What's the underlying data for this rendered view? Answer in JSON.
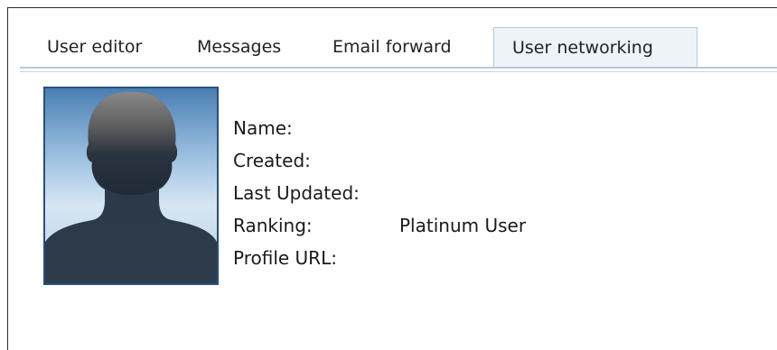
{
  "tabs": [
    {
      "label": "User editor",
      "active": false
    },
    {
      "label": "Messages",
      "active": false
    },
    {
      "label": "Email forward",
      "active": false
    },
    {
      "label": "User networking",
      "active": true
    }
  ],
  "profile": {
    "avatar_icon": "person-silhouette-icon",
    "fields": [
      {
        "label": "Name:",
        "value": ""
      },
      {
        "label": "Created:",
        "value": ""
      },
      {
        "label": "Last Updated:",
        "value": ""
      },
      {
        "label": "Ranking:",
        "value": "Platinum User"
      },
      {
        "label": "Profile URL:",
        "value": ""
      }
    ]
  },
  "colors": {
    "tab_border": "#b9c9d8",
    "active_tab_bg": "#eef3f8",
    "avatar_border": "#27507c"
  }
}
